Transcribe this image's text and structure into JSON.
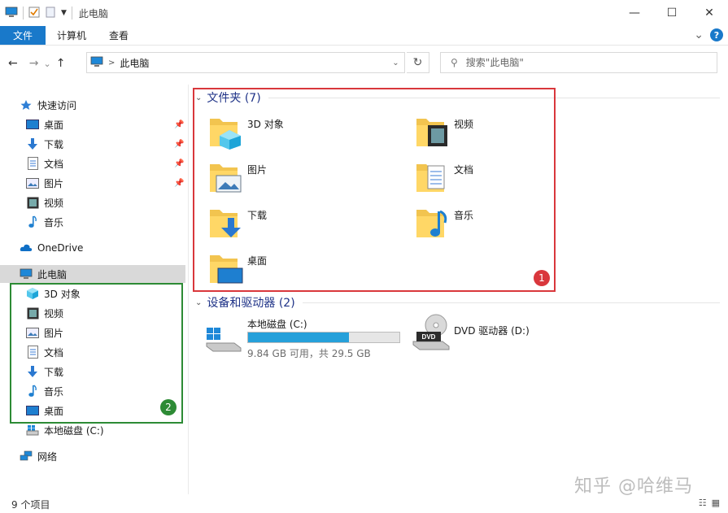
{
  "window": {
    "title": "此电脑",
    "buttons": {
      "minimize": "—",
      "maximize": "☐",
      "close": "✕"
    }
  },
  "ribbon": {
    "tabs": [
      {
        "label": "文件"
      },
      {
        "label": "计算机"
      },
      {
        "label": "查看"
      }
    ],
    "expand": "⌄",
    "help": "?"
  },
  "address": {
    "back": "←",
    "forward": "→",
    "recent": "⌄",
    "up": "↑",
    "path": "此电脑",
    "dropdown": "⌄",
    "refresh": "↻",
    "search_placeholder": "搜索\"此电脑\""
  },
  "sidebar": {
    "quick_access": {
      "label": "快速访问"
    },
    "pinned": [
      {
        "label": "桌面",
        "icon": "desktop-icon",
        "pinned": true
      },
      {
        "label": "下载",
        "icon": "download-icon",
        "pinned": true
      },
      {
        "label": "文档",
        "icon": "documents-icon",
        "pinned": true
      },
      {
        "label": "图片",
        "icon": "pictures-icon",
        "pinned": true
      },
      {
        "label": "视频",
        "icon": "videos-icon",
        "pinned": false
      },
      {
        "label": "音乐",
        "icon": "music-icon",
        "pinned": false
      }
    ],
    "onedrive": "OneDrive",
    "this_pc": "此电脑",
    "pc_children": [
      {
        "label": "3D 对象",
        "icon": "3d-objects-icon"
      },
      {
        "label": "视频",
        "icon": "videos-icon"
      },
      {
        "label": "图片",
        "icon": "pictures-icon"
      },
      {
        "label": "文档",
        "icon": "documents-icon"
      },
      {
        "label": "下载",
        "icon": "download-icon"
      },
      {
        "label": "音乐",
        "icon": "music-icon"
      },
      {
        "label": "桌面",
        "icon": "desktop-icon"
      },
      {
        "label": "本地磁盘 (C:)",
        "icon": "local-disk-icon"
      }
    ],
    "network": "网络"
  },
  "content": {
    "folders_header": "文件夹 (7)",
    "folders": [
      {
        "label": "3D 对象",
        "icon": "3d-objects-folder-icon"
      },
      {
        "label": "视频",
        "icon": "videos-folder-icon"
      },
      {
        "label": "图片",
        "icon": "pictures-folder-icon"
      },
      {
        "label": "文档",
        "icon": "documents-folder-icon"
      },
      {
        "label": "下载",
        "icon": "download-folder-icon"
      },
      {
        "label": "音乐",
        "icon": "music-folder-icon"
      },
      {
        "label": "桌面",
        "icon": "desktop-folder-icon"
      }
    ],
    "devices_header": "设备和驱动器 (2)",
    "drives": [
      {
        "label": "本地磁盘 (C:)",
        "free_text": "9.84 GB 可用，共 29.5 GB",
        "used_fraction": 0.667
      },
      {
        "label": "DVD 驱动器 (D:)"
      }
    ]
  },
  "annotations": {
    "badge1": "1",
    "badge2": "2"
  },
  "status": {
    "item_count": "9 个项目"
  },
  "watermark": "知乎 @哈维马",
  "colors": {
    "accent": "#1979ca",
    "annotation_red": "#d9373c",
    "annotation_green": "#2d8b35",
    "drive_fill": "#26a0da"
  }
}
